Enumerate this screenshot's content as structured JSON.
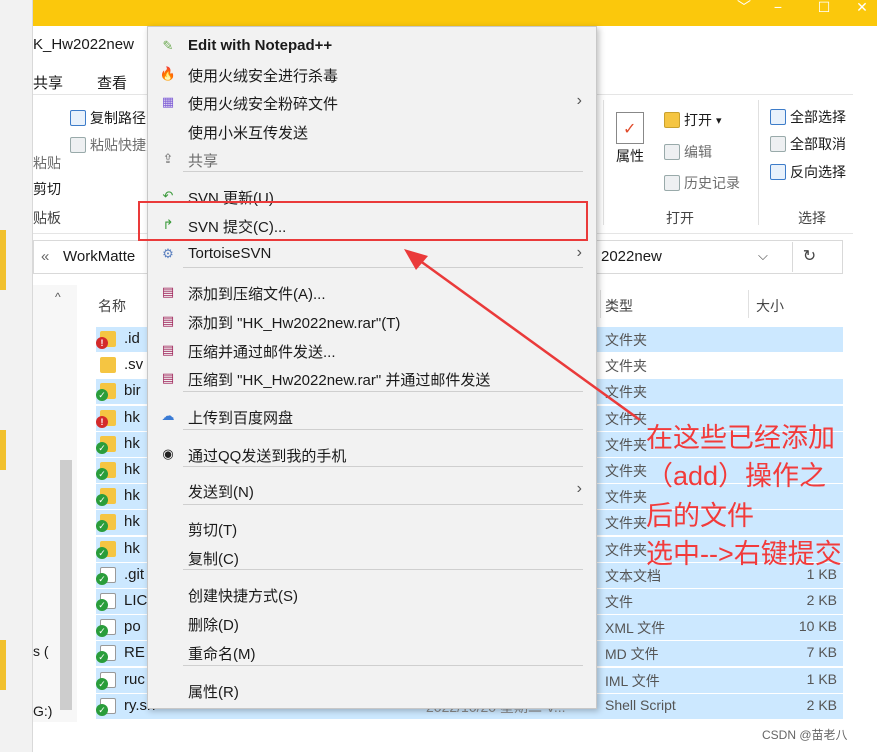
{
  "window": {
    "tab_title": "K_Hw2022new",
    "controls": [
      "﹀",
      "−",
      "☐",
      "✕"
    ]
  },
  "ribbon": {
    "tabs": [
      "共享",
      "查看"
    ],
    "copy_path": "复制路径",
    "paste_shortcut": "粘贴快捷方式",
    "paste": "粘贴",
    "cut": "剪切",
    "clipboard_group": "贴板",
    "properties": "属性",
    "open": "打开",
    "open_caret": "▾",
    "edit": "编辑",
    "history": "历史记录",
    "open_group": "打开",
    "select_all": "全部选择",
    "select_none": "全部取消",
    "invert_selection": "反向选择",
    "select_group": "选择"
  },
  "address": {
    "back": "«",
    "path_left": "WorkMatte",
    "path_right": "2022new",
    "dropdown": "⌵",
    "refresh": "↻"
  },
  "columns": {
    "name": "名称",
    "type": "类型",
    "size": "大小"
  },
  "nav": {
    "scroll_up": "^",
    "items": [
      "s (",
      "G:)"
    ]
  },
  "files": [
    {
      "name": ".id",
      "type": "文件夹",
      "size": "",
      "selected": true,
      "kind": "folder",
      "status": "err",
      "date": ""
    },
    {
      "name": ".sv",
      "type": "文件夹",
      "size": "",
      "selected": false,
      "kind": "folder",
      "status": "",
      "date": ""
    },
    {
      "name": "bir",
      "type": "文件夹",
      "size": "",
      "selected": true,
      "kind": "folder",
      "status": "ok",
      "date": ""
    },
    {
      "name": "hk",
      "type": "文件夹",
      "size": "",
      "selected": true,
      "kind": "folder",
      "status": "err",
      "date": ""
    },
    {
      "name": "hk",
      "type": "文件夹",
      "size": "",
      "selected": true,
      "kind": "folder",
      "status": "ok",
      "date": ""
    },
    {
      "name": "hk",
      "type": "文件夹",
      "size": "",
      "selected": true,
      "kind": "folder",
      "status": "ok",
      "date": ""
    },
    {
      "name": "hk",
      "type": "文件夹",
      "size": "",
      "selected": true,
      "kind": "folder",
      "status": "ok",
      "date": ""
    },
    {
      "name": "hk",
      "type": "文件夹",
      "size": "",
      "selected": true,
      "kind": "folder",
      "status": "ok",
      "date": ""
    },
    {
      "name": "hk",
      "type": "文件夹",
      "size": "",
      "selected": true,
      "kind": "folder",
      "status": "ok",
      "date": ""
    },
    {
      "name": ".git",
      "type": "文本文档",
      "size": "1 KB",
      "selected": true,
      "kind": "file",
      "status": "ok",
      "date": ""
    },
    {
      "name": "LIC",
      "type": "文件",
      "size": "2 KB",
      "selected": true,
      "kind": "file",
      "status": "ok",
      "date": ""
    },
    {
      "name": "po",
      "type": "XML 文件",
      "size": "10 KB",
      "selected": true,
      "kind": "file",
      "status": "ok",
      "date": ""
    },
    {
      "name": "RE",
      "type": "MD 文件",
      "size": "7 KB",
      "selected": true,
      "kind": "file",
      "status": "ok",
      "date": ""
    },
    {
      "name": "ruc",
      "type": "IML 文件",
      "size": "1 KB",
      "selected": true,
      "kind": "file",
      "status": "ok",
      "date": ""
    },
    {
      "name": "ry.sh",
      "type": "Shell Script",
      "size": "2 KB",
      "selected": true,
      "kind": "file",
      "status": "ok",
      "date": "2022/10/20 星期二 V..."
    }
  ],
  "context_menu": {
    "items": [
      {
        "label": "Edit with Notepad++",
        "icon": "notepad-icon",
        "glyph": "✎",
        "bold": true
      },
      {
        "label": "使用火绒安全进行杀毒",
        "icon": "huorong-icon",
        "glyph": "🔥"
      },
      {
        "label": "使用火绒安全粉碎文件",
        "icon": "shredder-icon",
        "glyph": "▦",
        "submenu": true
      },
      {
        "label": "使用小米互传发送",
        "icon": "",
        "glyph": ""
      },
      {
        "label": "共享",
        "icon": "share-icon",
        "glyph": "⇪",
        "disabled": true
      },
      {
        "label": "SVN 更新(U)",
        "icon": "svn-update-icon",
        "glyph": "↶"
      },
      {
        "label": "SVN 提交(C)...",
        "icon": "svn-commit-icon",
        "glyph": "↱"
      },
      {
        "label": "TortoiseSVN",
        "icon": "tortoisesvn-icon",
        "glyph": "⚙",
        "submenu": true
      },
      {
        "label": "添加到压缩文件(A)...",
        "icon": "winrar-icon",
        "glyph": "▤"
      },
      {
        "label": "添加到 \"HK_Hw2022new.rar\"(T)",
        "icon": "winrar-icon",
        "glyph": "▤"
      },
      {
        "label": "压缩并通过邮件发送...",
        "icon": "winrar-icon",
        "glyph": "▤"
      },
      {
        "label": "压缩到 \"HK_Hw2022new.rar\" 并通过邮件发送",
        "icon": "winrar-icon",
        "glyph": "▤"
      },
      {
        "label": "上传到百度网盘",
        "icon": "baidu-netdisk-icon",
        "glyph": "☁"
      },
      {
        "label": "通过QQ发送到我的手机",
        "icon": "qq-icon",
        "glyph": "◉"
      },
      {
        "label": "发送到(N)",
        "icon": "",
        "glyph": "",
        "submenu": true
      },
      {
        "label": "剪切(T)",
        "icon": "",
        "glyph": ""
      },
      {
        "label": "复制(C)",
        "icon": "",
        "glyph": ""
      },
      {
        "label": "创建快捷方式(S)",
        "icon": "",
        "glyph": ""
      },
      {
        "label": "删除(D)",
        "icon": "",
        "glyph": ""
      },
      {
        "label": "重命名(M)",
        "icon": "",
        "glyph": ""
      },
      {
        "label": "属性(R)",
        "icon": "",
        "glyph": ""
      }
    ],
    "submenu_arrow": "›"
  },
  "annotation": {
    "lines": [
      "在这些已经添加",
      "（add）操作之",
      "后的文件",
      "选中-->右键提交"
    ],
    "color": "#f23b3b"
  },
  "watermark": "CSDN @苗老八"
}
